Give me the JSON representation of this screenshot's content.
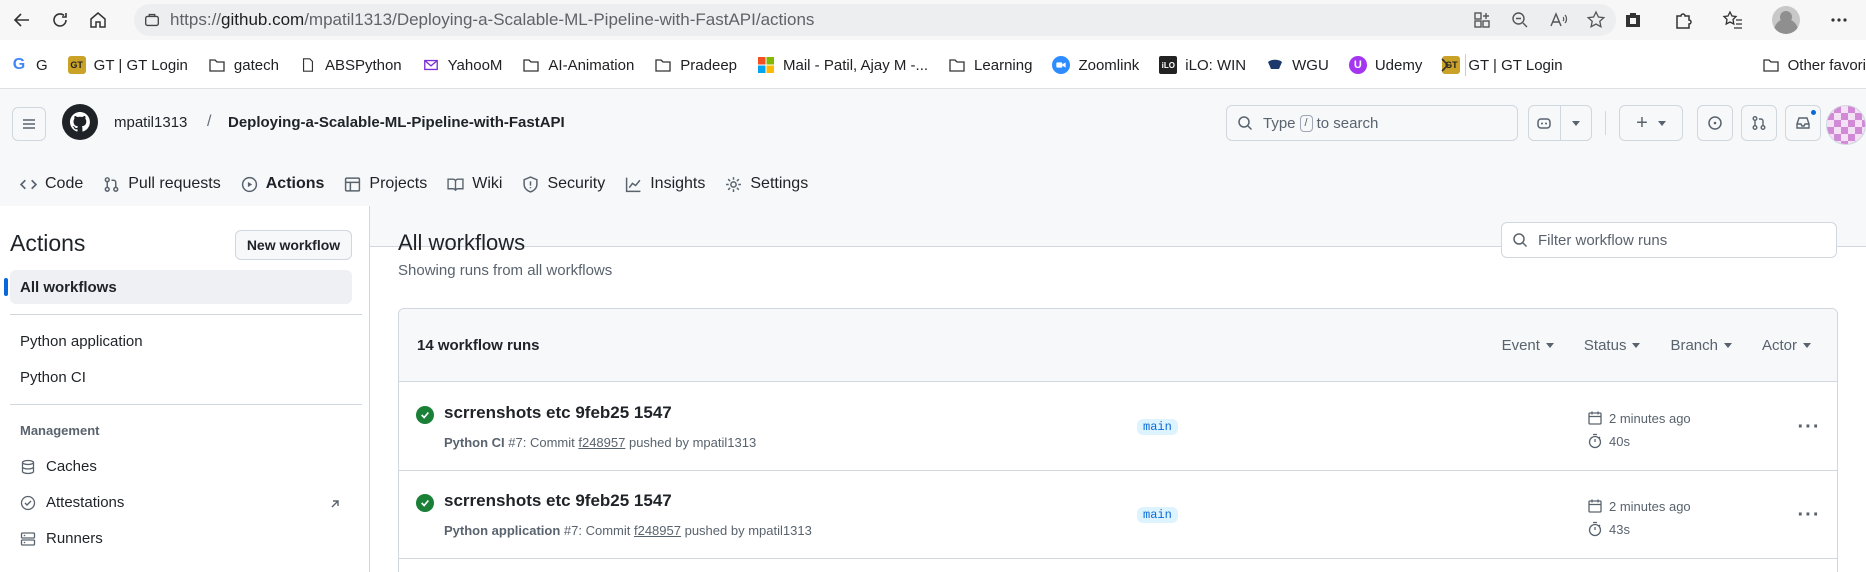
{
  "browser": {
    "url_prefix": "https://",
    "url_host": "github.com",
    "url_path": "/mpatil1313/Deploying-a-Scalable-ML-Pipeline-with-FastAPI/actions"
  },
  "bookmarks": [
    {
      "label": "G",
      "icon": "google-icon"
    },
    {
      "label": "GT | GT Login",
      "icon": "gt-icon"
    },
    {
      "label": "gatech",
      "icon": "folder-icon"
    },
    {
      "label": "ABSPython",
      "icon": "page-icon"
    },
    {
      "label": "YahooM",
      "icon": "mail-icon"
    },
    {
      "label": "AI-Animation",
      "icon": "folder-icon"
    },
    {
      "label": "Pradeep",
      "icon": "folder-icon"
    },
    {
      "label": "Mail - Patil, Ajay M -...",
      "icon": "microsoft-icon"
    },
    {
      "label": "Learning",
      "icon": "folder-icon"
    },
    {
      "label": "Zoomlink",
      "icon": "zoom-icon"
    },
    {
      "label": "iLO: WIN",
      "icon": "ilo-icon"
    },
    {
      "label": "WGU",
      "icon": "wgu-icon"
    },
    {
      "label": "Udemy",
      "icon": "udemy-icon"
    },
    {
      "label": "GT | GT Login",
      "icon": "gt-icon"
    }
  ],
  "bookmarks_other": "Other favori",
  "repo": {
    "owner": "mpatil1313",
    "slash": "/",
    "name": "Deploying-a-Scalable-ML-Pipeline-with-FastAPI"
  },
  "search": {
    "prefix": "Type",
    "key": "/",
    "suffix": "to search"
  },
  "tabs": [
    {
      "label": "Code",
      "icon": "code-icon",
      "active": false
    },
    {
      "label": "Pull requests",
      "icon": "pull-request-icon",
      "active": false
    },
    {
      "label": "Actions",
      "icon": "play-icon",
      "active": true
    },
    {
      "label": "Projects",
      "icon": "table-icon",
      "active": false
    },
    {
      "label": "Wiki",
      "icon": "book-icon",
      "active": false
    },
    {
      "label": "Security",
      "icon": "shield-icon",
      "active": false
    },
    {
      "label": "Insights",
      "icon": "graph-icon",
      "active": false
    },
    {
      "label": "Settings",
      "icon": "gear-icon",
      "active": false
    }
  ],
  "sidebar": {
    "title": "Actions",
    "new_workflow": "New workflow",
    "all_workflows": "All workflows",
    "workflows": [
      "Python application",
      "Python CI"
    ],
    "management_heading": "Management",
    "management_items": [
      {
        "label": "Caches",
        "icon": "database-icon"
      },
      {
        "label": "Attestations",
        "icon": "verified-icon"
      },
      {
        "label": "Runners",
        "icon": "server-icon"
      }
    ]
  },
  "main": {
    "title": "All workflows",
    "subtitle": "Showing runs from all workflows",
    "filter_placeholder": "Filter workflow runs",
    "runs_count": "14 workflow runs",
    "filters": [
      "Event",
      "Status",
      "Branch",
      "Actor"
    ],
    "runs": [
      {
        "title": "scrrenshots etc 9feb25 1547",
        "workflow": "Python CI",
        "meta": " #7: Commit ",
        "sha": "f248957",
        "pushed_by": " pushed by mpatil1313",
        "branch": "main",
        "time": "2 minutes ago",
        "duration": "40s",
        "status": "success"
      },
      {
        "title": "scrrenshots etc 9feb25 1547",
        "workflow": "Python application",
        "meta": " #7: Commit ",
        "sha": "f248957",
        "pushed_by": " pushed by mpatil1313",
        "branch": "main",
        "time": "2 minutes ago",
        "duration": "43s",
        "status": "success"
      }
    ]
  },
  "colors": {
    "accent_blue": "#0969da",
    "success_green": "#1a7f37",
    "active_tab_underline": "#fd8c73"
  }
}
